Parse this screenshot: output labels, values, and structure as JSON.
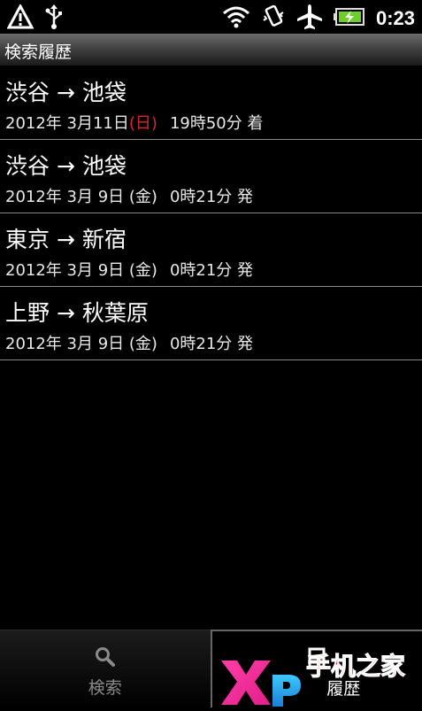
{
  "status_bar": {
    "time": "0:23",
    "icons": [
      "warning-icon",
      "usb-icon",
      "wifi-icon",
      "vibrate-icon",
      "airplane-icon",
      "battery-icon"
    ]
  },
  "title_bar": {
    "title": "検索履歴"
  },
  "history": [
    {
      "route": "渋谷 → 池袋",
      "date": "2012年 3月11日",
      "dow": "(日)",
      "time_text": "19時50分 着",
      "dow_color": "#d8262a"
    },
    {
      "route": "渋谷 → 池袋",
      "date": "2012年 3月 9日",
      "dow": "(金)",
      "time_text": "0時21分 発"
    },
    {
      "route": "東京 → 新宿",
      "date": "2012年 3月 9日",
      "dow": "(金)",
      "time_text": "0時21分 発"
    },
    {
      "route": "上野 → 秋葉原",
      "date": "2012年 3月 9日",
      "dow": "(金)",
      "time_text": "0時21分 発"
    }
  ],
  "tabs": {
    "search_label": "検索",
    "history_label": "履歴"
  },
  "watermark": {
    "text": "手机之家"
  }
}
